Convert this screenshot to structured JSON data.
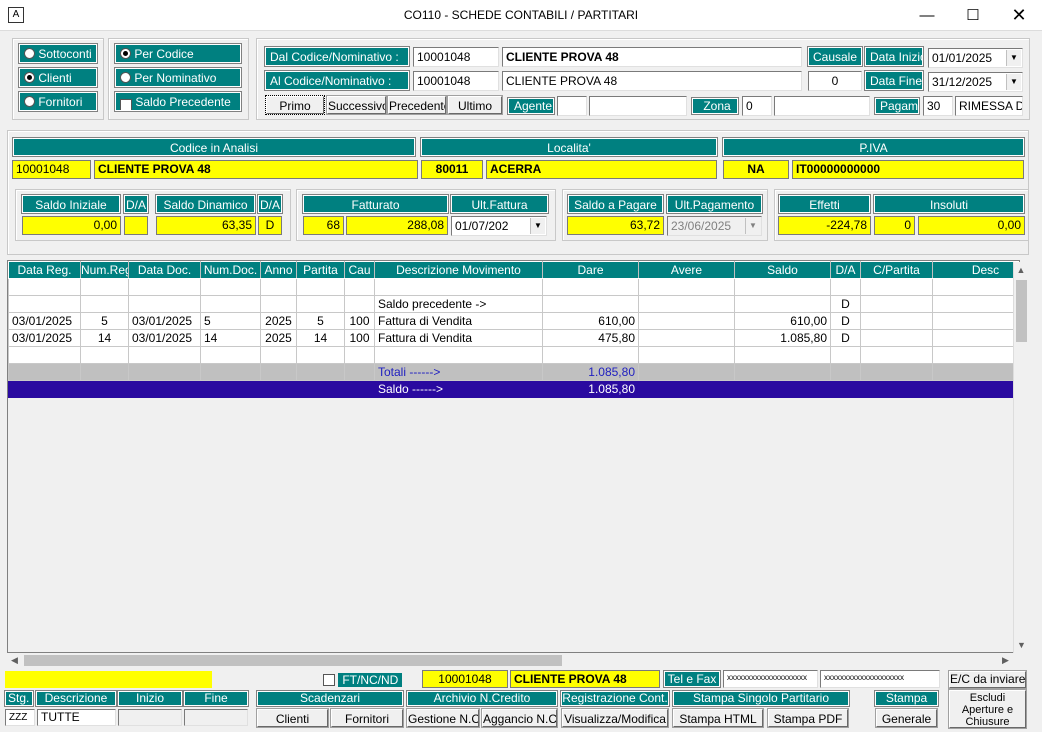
{
  "window": {
    "title": "CO110 - SCHEDE CONTABILI / PARTITARI",
    "icon": "A"
  },
  "mode": {
    "options": [
      "Sottoconti",
      "Clienti",
      "Fornitori"
    ],
    "selected": "Clienti"
  },
  "order": {
    "per_codice": "Per Codice",
    "per_nominativo": "Per Nominativo",
    "saldo_precedente": "Saldo Precedente"
  },
  "filters": {
    "dal_label": "Dal Codice/Nominativo :",
    "dal_code": "10001048",
    "dal_name": "CLIENTE PROVA 48",
    "al_label": "Al Codice/Nominativo :",
    "al_code": "10001048",
    "al_name": "CLIENTE PROVA 48",
    "causale_label": "Causale",
    "causale_value": "0",
    "data_inizio_label": "Data Inizio :",
    "data_inizio": "01/01/2025",
    "data_fine_label": "Data Fine :",
    "data_fine": "31/12/2025",
    "agente_label": "Agente",
    "zona_label": "Zona",
    "zona_value": "0",
    "pagam_label": "Pagam.",
    "pagam_code": "30",
    "pagam_desc": "RIMESSA DIR"
  },
  "nav": {
    "primo": "Primo",
    "successivo": "Successivo",
    "precedente": "Precedente",
    "ultimo": "Ultimo"
  },
  "analysis": {
    "codice_label": "Codice in Analisi",
    "localita_label": "Localita'",
    "piva_label": "P.IVA",
    "codice": "10001048",
    "nome": "CLIENTE PROVA 48",
    "cap": "80011",
    "citta": "ACERRA",
    "prov": "NA",
    "piva": "IT00000000000"
  },
  "summary": {
    "saldo_iniziale_label": "Saldo Iniziale",
    "da1_label": "D/A",
    "saldo_iniziale": "0,00",
    "da1": "",
    "saldo_dinamico_label": "Saldo Dinamico",
    "da2_label": "D/A",
    "saldo_dinamico": "63,35",
    "da2": "D",
    "fatturato_label": "Fatturato",
    "fatturato_n": "68",
    "fatturato": "288,08",
    "ult_fattura_label": "Ult.Fattura",
    "ult_fattura": "01/07/202",
    "saldo_pagare_label": "Saldo a Pagare",
    "saldo_pagare": "63,72",
    "ult_pagamento_label": "Ult.Pagamento",
    "ult_pagamento": "23/06/2025",
    "effetti_label": "Effetti",
    "effetti": "-224,78",
    "insoluti_label": "Insoluti",
    "insoluti_n": "0",
    "insoluti": "0,00"
  },
  "table": {
    "columns": [
      "Data Reg.",
      "Num.Reg",
      "Data Doc.",
      "Num.Doc.",
      "Anno",
      "Partita",
      "Cau",
      "Descrizione Movimento",
      "Dare",
      "Avere",
      "Saldo",
      "D/A",
      "C/Partita",
      "Desc"
    ],
    "rows": [
      [
        "",
        "",
        "",
        "",
        "",
        "",
        "",
        "",
        "",
        "",
        "",
        "",
        "",
        ""
      ],
      [
        "",
        "",
        "",
        "",
        "",
        "",
        "",
        "Saldo precedente ->",
        "",
        "",
        "",
        "D",
        "",
        ""
      ],
      [
        "03/01/2025",
        "5",
        "03/01/2025",
        "5",
        "2025",
        "5",
        "100",
        "Fattura di Vendita",
        "610,00",
        "",
        "610,00",
        "D",
        "",
        ""
      ],
      [
        "03/01/2025",
        "14",
        "03/01/2025",
        "14",
        "2025",
        "14",
        "100",
        "Fattura di Vendita",
        "475,80",
        "",
        "1.085,80",
        "D",
        "",
        ""
      ],
      [
        "",
        "",
        "",
        "",
        "",
        "",
        "",
        "",
        "",
        "",
        "",
        "",
        "",
        ""
      ]
    ],
    "totali_label": "Totali ------>",
    "totali_dare": "1.085,80",
    "saldo_label": "Saldo  ------>",
    "saldo_value": "1.085,80"
  },
  "footer": {
    "ft_label": "FT/NC/ND",
    "codice": "10001048",
    "nome": "CLIENTE PROVA 48",
    "telfax_label": "Tel e Fax",
    "tel": "xxxxxxxxxxxxxxxxxxxx",
    "fax": "xxxxxxxxxxxxxxxxxxxx",
    "ec_label": "E/C da inviare",
    "stg_label": "Stg.",
    "descr_label": "Descrizione",
    "inizio_label": "Inizio",
    "fine_label": "Fine",
    "stg_value": "ZZZ",
    "descr_value": "TUTTE",
    "scadenzari_label": "Scadenzari",
    "clienti_btn": "Clienti",
    "fornitori_btn": "Fornitori",
    "archivio_label": "Archivio N.Credito",
    "gestione_btn": "Gestione N.C.",
    "aggancio_btn": "Aggancio N.C.",
    "registrazione_label": "Registrazione Cont.",
    "visualizza_btn": "Visualizza/Modifica",
    "stampa_singolo_label": "Stampa Singolo Partitario",
    "html_btn": "Stampa HTML",
    "pdf_btn": "Stampa PDF",
    "stampa_label": "Stampa",
    "generale_btn": "Generale",
    "escludi_btn": "Escludi Aperture e Chiusure"
  }
}
